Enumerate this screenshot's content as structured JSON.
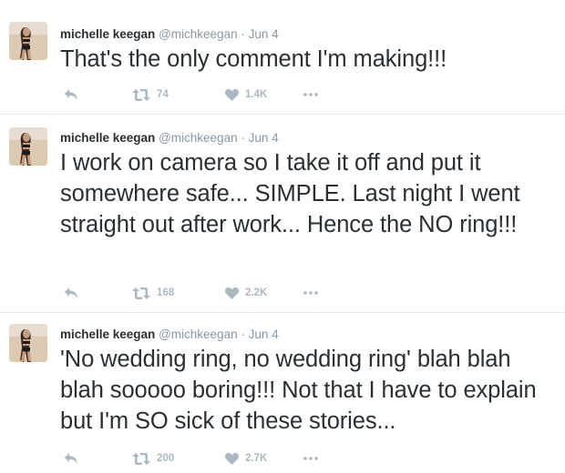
{
  "tweets": [
    {
      "author_name": "michelle keegan",
      "handle": "@michkeegan",
      "separator": "·",
      "date": "Jun 4",
      "text": "That's the only comment I'm making!!!",
      "retweets": "74",
      "likes": "1.4K"
    },
    {
      "author_name": "michelle keegan",
      "handle": "@michkeegan",
      "separator": "·",
      "date": "Jun 4",
      "text": "I work on camera so I take it off and put it somewhere safe... SIMPLE. Last night I went straight out after work... Hence the NO ring!!!",
      "retweets": "168",
      "likes": "2.2K"
    },
    {
      "author_name": "michelle keegan",
      "handle": "@michkeegan",
      "separator": "·",
      "date": "Jun 4",
      "text": "'No wedding ring, no wedding ring' blah blah blah sooooo boring!!! Not that I have to explain but I'm SO sick of these stories...",
      "retweets": "200",
      "likes": "2.7K"
    }
  ],
  "icons": {
    "reply": "reply-icon",
    "retweet": "retweet-icon",
    "like": "heart-icon",
    "more": "more-icon"
  },
  "colors": {
    "text": "#292f33",
    "secondary": "#8899a6",
    "action": "#aab8c2",
    "divider": "#e1e8ed"
  }
}
